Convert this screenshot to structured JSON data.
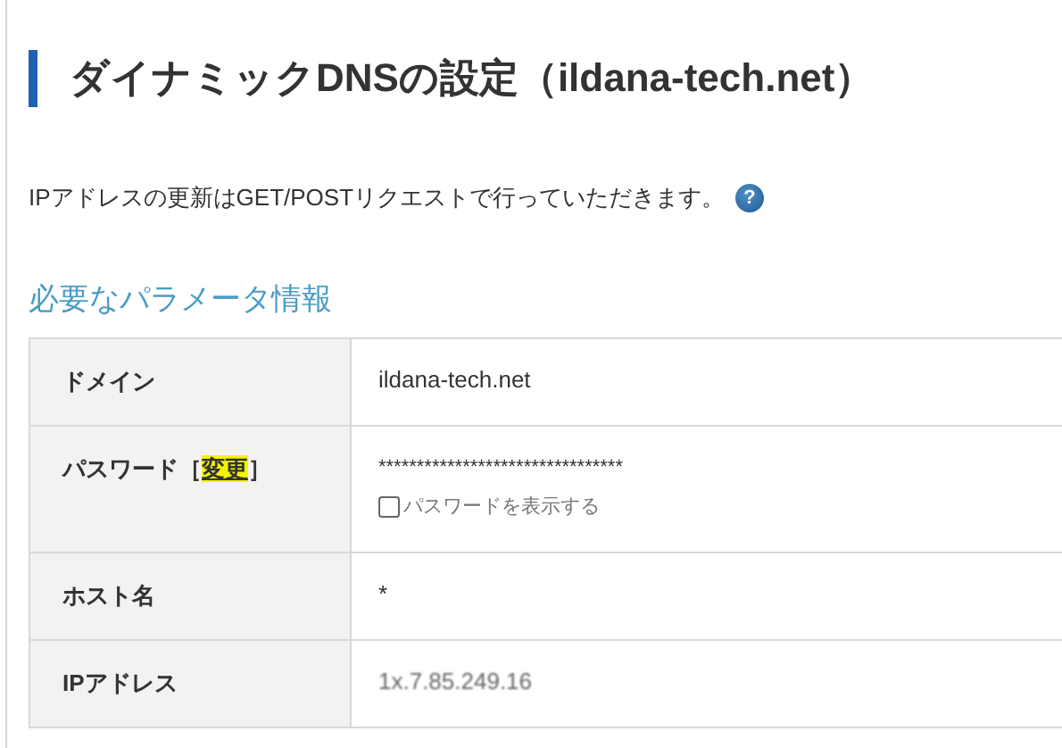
{
  "title": "ダイナミックDNSの設定（ildana-tech.net）",
  "description": "IPアドレスの更新はGET/POSTリクエストで行っていただきます。",
  "help_icon": "?",
  "section_heading": "必要なパラメータ情報",
  "rows": [
    {
      "kind": "text",
      "label": "ドメイン",
      "value": "ildana-tech.net"
    },
    {
      "kind": "password",
      "label": "パスワード［",
      "link": "変更",
      "label_end": "］",
      "highlighted": true,
      "value": "********************************",
      "checkbox": {
        "label": "パスワードを表示する",
        "checked": false
      }
    },
    {
      "kind": "text",
      "label": "ホスト名",
      "value": "*"
    },
    {
      "kind": "masked",
      "label": "IPアドレス",
      "value": "1x.7.85.249.16"
    }
  ]
}
